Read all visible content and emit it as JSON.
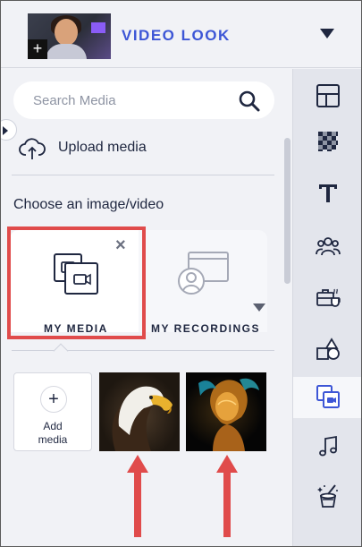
{
  "header": {
    "title": "VIDEO LOOK"
  },
  "search": {
    "placeholder": "Search Media"
  },
  "upload": {
    "label": "Upload media"
  },
  "section": {
    "choose_label": "Choose an image/video"
  },
  "tabs": [
    {
      "label": "MY MEDIA",
      "selected": true
    },
    {
      "label": "MY RECORDINGS",
      "selected": false
    }
  ],
  "media_grid": {
    "add_label_line1": "Add",
    "add_label_line2": "media",
    "items": [
      "eagle-image",
      "fire-portrait-image"
    ]
  },
  "rail": {
    "items": [
      "layout-icon",
      "background-icon",
      "text-icon",
      "people-icon",
      "briefcase-icon",
      "shapes-icon",
      "media-icon",
      "music-icon",
      "effects-icon"
    ],
    "active": "media-icon"
  },
  "colors": {
    "accent": "#3d56d6",
    "highlight": "#e04b4b",
    "arrow": "#e04b4b"
  }
}
